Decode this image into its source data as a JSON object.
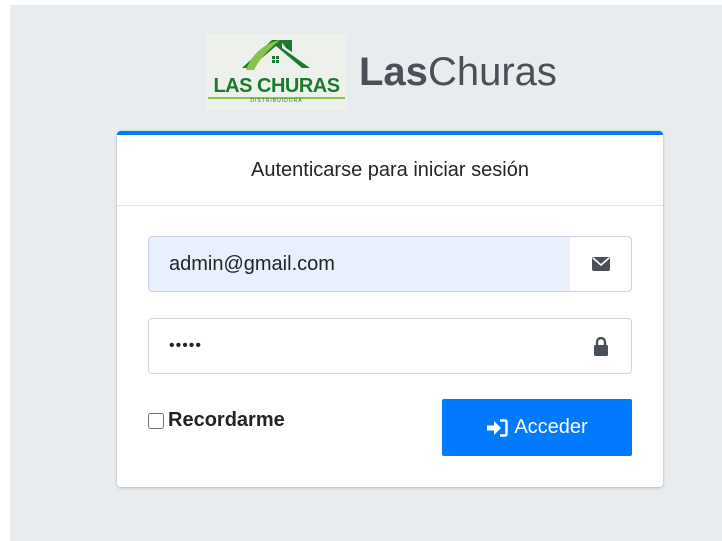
{
  "brand": {
    "logo_text": "LAS CHURAS",
    "logo_subtext": "DISTRIBUIDORA",
    "name_bold": "Las",
    "name_regular": "Churas"
  },
  "login": {
    "header": "Autenticarse para iniciar sesión",
    "email_value": "admin@gmail.com",
    "email_icon": "envelope-icon",
    "password_masked": "•••••",
    "password_icon": "lock-icon",
    "remember_label": "Recordarme",
    "remember_checked": false,
    "submit_label": "Acceder",
    "submit_icon": "sign-in-icon"
  },
  "colors": {
    "accent": "#007bff",
    "background": "#e9ecef",
    "logo_green": "#1b7a2e",
    "autofill": "#e8f0fe"
  }
}
